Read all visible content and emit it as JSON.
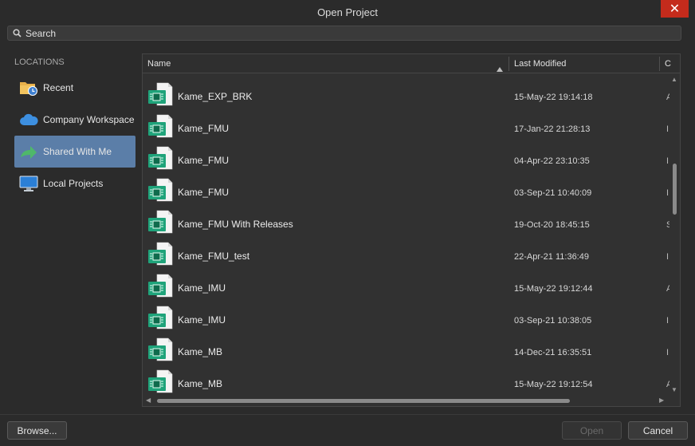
{
  "window": {
    "title": "Open Project",
    "close_glyph": "✕"
  },
  "search": {
    "placeholder": "Search"
  },
  "sidebar": {
    "heading": "LOCATIONS",
    "items": [
      {
        "label": "Recent",
        "icon": "recent-folder-icon",
        "active": false
      },
      {
        "label": "Company Workspace",
        "icon": "cloud-icon",
        "active": false
      },
      {
        "label": "Shared With Me",
        "icon": "shared-arrow-icon",
        "active": true
      },
      {
        "label": "Local Projects",
        "icon": "monitor-icon",
        "active": false
      }
    ]
  },
  "list": {
    "columns": [
      "Name",
      "Last Modified",
      "C"
    ],
    "sorted_column": "Name",
    "rows": [
      {
        "name": "Kame_EXP_BRK",
        "modified": "15-May-22 19:14:18",
        "extra": "A"
      },
      {
        "name": "Kame_FMU",
        "modified": "17-Jan-22 21:28:13",
        "extra": "I"
      },
      {
        "name": "Kame_FMU",
        "modified": "04-Apr-22 23:10:35",
        "extra": "I"
      },
      {
        "name": "Kame_FMU",
        "modified": "03-Sep-21 10:40:09",
        "extra": "I"
      },
      {
        "name": "Kame_FMU With Releases",
        "modified": "19-Oct-20 18:45:15",
        "extra": "S"
      },
      {
        "name": "Kame_FMU_test",
        "modified": "22-Apr-21 11:36:49",
        "extra": "I"
      },
      {
        "name": "Kame_IMU",
        "modified": "15-May-22 19:12:44",
        "extra": "A"
      },
      {
        "name": "Kame_IMU",
        "modified": "03-Sep-21 10:38:05",
        "extra": "I"
      },
      {
        "name": "Kame_MB",
        "modified": "14-Dec-21 16:35:51",
        "extra": "I"
      },
      {
        "name": "Kame_MB",
        "modified": "15-May-22 19:12:54",
        "extra": "A"
      }
    ]
  },
  "footer": {
    "browse_label": "Browse...",
    "open_label": "Open",
    "cancel_label": "Cancel"
  },
  "colors": {
    "accent": "#5b7ea8",
    "close": "#c42b1c",
    "pcb_green": "#1fa37a"
  }
}
